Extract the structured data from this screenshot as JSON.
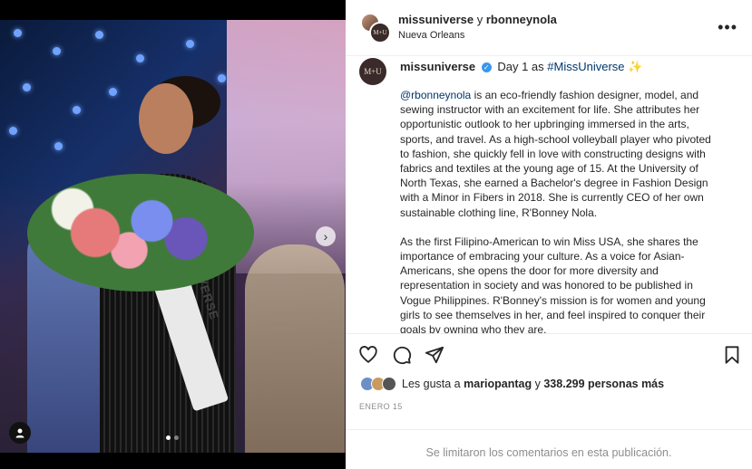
{
  "header": {
    "author": "missuniverse",
    "conjunction": "y",
    "collaborator": "rbonneynola",
    "location": "Nueva Orleans",
    "avatar_initials": "M+U",
    "more_icon": "more-horizontal-icon"
  },
  "media": {
    "sash_text": "VERSE",
    "next_icon": "chevron-right-icon",
    "user_tag_icon": "person-icon",
    "page_count": 2,
    "current_page": 1
  },
  "caption": {
    "username": "missuniverse",
    "headline_prefix": "Day 1 as",
    "hashtag": "#MissUniverse",
    "emoji": "✨",
    "mention": "@rbonneynola",
    "paragraph1_rest": " is an eco-friendly fashion designer, model, and sewing instructor with an excitement for life. She attributes her opportunistic outlook to her upbringing immersed in the arts, sports, and travel. As a high-school volleyball player who pivoted to fashion, she quickly fell in love with constructing designs with fabrics and textiles at the young age of 15. At the University of North Texas, she earned a Bachelor's degree in Fashion Design with a Minor in Fibers in 2018. She is currently CEO of her own sustainable clothing line, R'Bonney Nola.",
    "paragraph2": "As the first Filipino-American to win Miss USA, she shares the importance of embracing your culture. As a voice for Asian-Americans, she opens the door for more diversity and representation in society and was honored to be published in Vogue Philippines. R'Bonney's mission is for women and young girls to see themselves in her, and feel inspired to conquer their goals by owning who they are."
  },
  "actions": {
    "like_icon": "heart-icon",
    "comment_icon": "comment-icon",
    "share_icon": "send-icon",
    "save_icon": "bookmark-icon"
  },
  "likes": {
    "prefix": "Les gusta a",
    "user": "mariopantag",
    "middle": "y",
    "count": "338.299 personas más"
  },
  "date": "ENERO 15",
  "comments_disabled": "Se limitaron los comentarios en esta publicación."
}
